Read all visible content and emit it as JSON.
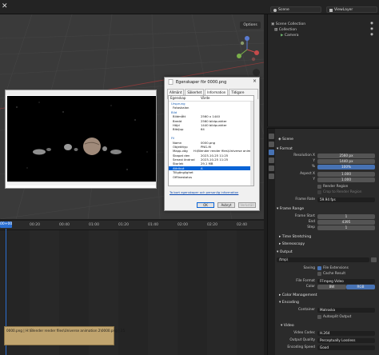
{
  "topbar": {
    "scene_label": "Scene",
    "view_layer_label": "ViewLayer"
  },
  "viewport": {
    "options_label": "Options",
    "gizmo_labels": [
      "Z",
      "X",
      "Y"
    ]
  },
  "dialog": {
    "title": "Egenskaper för 0000.png",
    "close": "×",
    "tabs": [
      "Allmänt",
      "Säkerhet",
      "Information",
      "Tidigare versioner"
    ],
    "active_tab": 2,
    "col_property": "Egenskap",
    "col_value": "Värde",
    "rows": [
      {
        "k": "Ursprung",
        "v": "",
        "section": true
      },
      {
        "k": "Fotoskalan",
        "v": ""
      },
      {
        "k": "Bild",
        "v": "",
        "section": true
      },
      {
        "k": "Bildmått",
        "v": "2560 x 1440"
      },
      {
        "k": "Bredd",
        "v": "2560 bildpunkter"
      },
      {
        "k": "Höjd",
        "v": "1440 bildpunkter"
      },
      {
        "k": "Bitdjup",
        "v": "64"
      },
      {
        "k": "",
        "v": ""
      },
      {
        "k": "Fil",
        "v": "",
        "section": true
      },
      {
        "k": "Namn",
        "v": "0000.png"
      },
      {
        "k": "Objekttyp",
        "v": "PNG-fil"
      },
      {
        "k": "Mapp-väg",
        "v": "H:\\Blender render files\\Universe anim..."
      },
      {
        "k": "Skapat den",
        "v": "2023-10-25 11:25"
      },
      {
        "k": "Senast ändrad",
        "v": "2023-10-25 11:25"
      },
      {
        "k": "Storlek",
        "v": "29,1 MB"
      },
      {
        "k": "Attribut",
        "v": "A",
        "sel": true
      },
      {
        "k": "Tillgänglighet",
        "v": ""
      },
      {
        "k": "Offlinestatus",
        "v": ""
      }
    ],
    "link": "Ta bort egenskaper och personlig information",
    "ok": "OK",
    "cancel": "Avbryt",
    "apply": "Verkställ"
  },
  "timeline": {
    "playhead": "00+00",
    "ticks": [
      "00:20",
      "00:40",
      "01:00",
      "01:20",
      "01:40",
      "02:00",
      "02:20",
      "02:40"
    ],
    "strip_label": "0000.png | H:\\Blender render files\\Universe animation 2\\0000.png | 25"
  },
  "outliner": {
    "rows": [
      "Scene Collection",
      "Collection",
      "Camera"
    ]
  },
  "properties": {
    "object": "Scene",
    "format": {
      "header": "Format",
      "res_x_label": "Resolution X",
      "res_x": "2560 px",
      "res_y_label": "Y",
      "res_y": "1440 px",
      "pct_label": "%",
      "pct": "100%",
      "aspect_x_label": "Aspect X",
      "aspect_x": "1.000",
      "aspect_y_label": "Y",
      "aspect_y": "1.000",
      "render_region": "Render Region",
      "crop": "Crop to Render Region",
      "frame_rate_label": "Frame Rate",
      "frame_rate": "59.94 fps"
    },
    "frame_range": {
      "header": "Frame Range",
      "start_label": "Frame Start",
      "start": "1",
      "end_label": "End",
      "end": "4395",
      "step_label": "Step",
      "step": "1"
    },
    "time_stretching": "Time Stretching",
    "stereoscopy": "Stereoscopy",
    "output": {
      "header": "Output",
      "path": "/tmp\\",
      "saving_label": "Saving",
      "file_ext": "File Extensions",
      "cache": "Cache Result",
      "file_format_label": "File Format",
      "file_format": "FFmpeg Video",
      "color_label": "Color",
      "bw": "BW",
      "rgb": "RGB"
    },
    "color_management": "Color Management",
    "encoding": {
      "header": "Encoding",
      "container_label": "Container",
      "container": "Matroska",
      "autosplit": "Autosplit Output"
    },
    "video": {
      "header": "Video",
      "codec_label": "Video Codec",
      "codec": "H.264",
      "quality_label": "Output Quality",
      "quality": "Perceptually Lossless",
      "speed_label": "Encoding Speed",
      "speed": "Good"
    }
  },
  "colors": {
    "accent": "#4772b3",
    "playhead": "#2b6fd1",
    "strip": "#c0a46e"
  }
}
